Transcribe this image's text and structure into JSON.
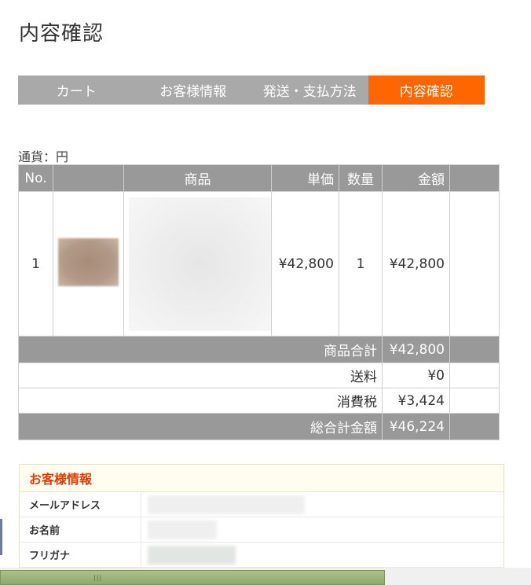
{
  "page": {
    "title": "内容確認"
  },
  "steps": [
    {
      "label": "カート",
      "active": false
    },
    {
      "label": "お客様情報",
      "active": false
    },
    {
      "label": "発送・支払方法",
      "active": false
    },
    {
      "label": "内容確認",
      "active": true
    }
  ],
  "currency_label": "通貨：円",
  "table": {
    "headers": {
      "no": "No.",
      "product": "商品",
      "unit_price": "単価",
      "quantity": "数量",
      "amount": "金額"
    },
    "items": [
      {
        "no": "1",
        "unit_price": "¥42,800",
        "quantity": "1",
        "amount": "¥42,800"
      }
    ],
    "summary": {
      "subtotal_label": "商品合計",
      "subtotal": "¥42,800",
      "shipping_label": "送料",
      "shipping": "¥0",
      "tax_label": "消費税",
      "tax": "¥3,424",
      "total_label": "総合計金額",
      "total": "¥46,224"
    }
  },
  "customer": {
    "title": "お客様情報",
    "fields": [
      {
        "label": "メールアドレス"
      },
      {
        "label": "お名前"
      },
      {
        "label": "フリガナ"
      }
    ]
  },
  "colors": {
    "step_active": "#ff6600",
    "step_inactive": "#a9a9a9",
    "header_gray": "#999999",
    "section_title": "#e03c00"
  }
}
